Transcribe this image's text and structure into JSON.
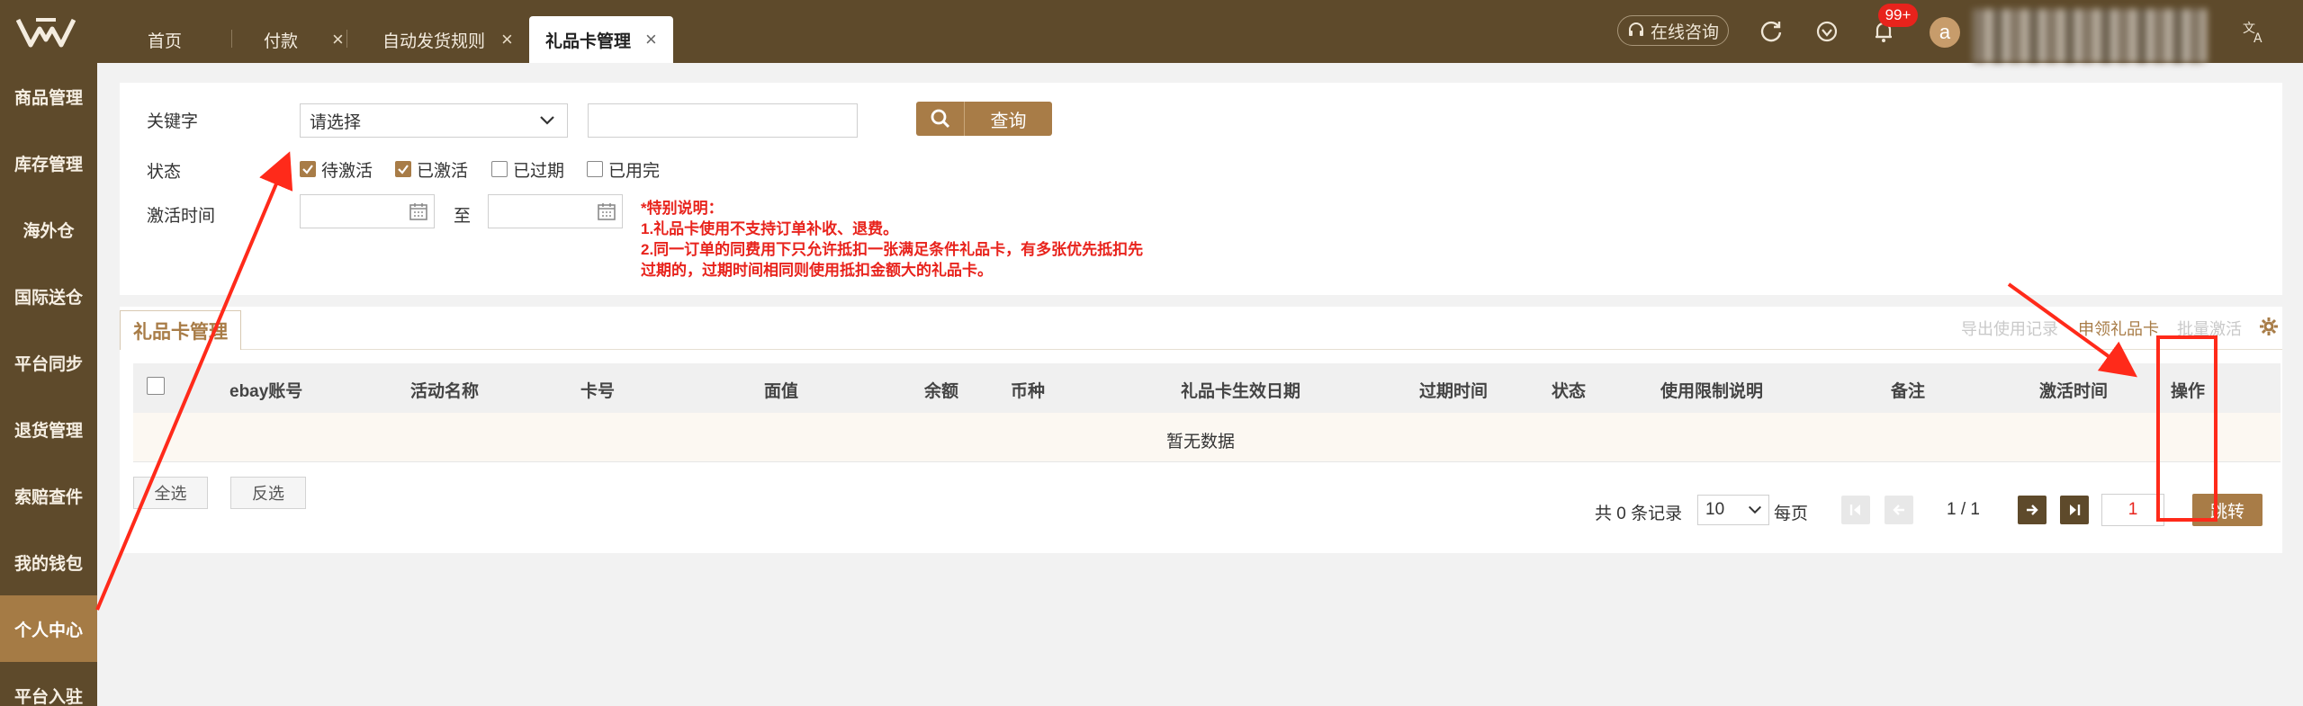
{
  "topbar": {
    "tabs": [
      {
        "label": "首页",
        "closable": false,
        "active": false
      },
      {
        "label": "付款",
        "closable": true,
        "active": false
      },
      {
        "label": "自动发货规则",
        "closable": true,
        "active": false
      },
      {
        "label": "礼品卡管理",
        "closable": true,
        "active": true
      }
    ],
    "close_glyph": "×",
    "consult_label": "在线咨询",
    "notification_count": "99+",
    "avatar_letter": "a",
    "icons": [
      "logo-icon",
      "headset-icon",
      "refresh-icon",
      "heart-icon",
      "bell-icon",
      "translate-icon"
    ]
  },
  "sidebar": {
    "items": [
      {
        "label": "商品管理"
      },
      {
        "label": "库存管理"
      },
      {
        "label": "海外仓"
      },
      {
        "label": "国际送仓"
      },
      {
        "label": "平台同步"
      },
      {
        "label": "退货管理"
      },
      {
        "label": "索赔查件"
      },
      {
        "label": "我的钱包"
      },
      {
        "label": "个人中心",
        "active": true
      },
      {
        "label": "平台入驻"
      }
    ]
  },
  "search": {
    "keyword_label": "关键字",
    "keyword_select_value": "请选择",
    "keyword_input_value": "",
    "query_label": "查询",
    "status_label": "状态",
    "statuses": [
      {
        "label": "待激活",
        "checked": true
      },
      {
        "label": "已激活",
        "checked": true
      },
      {
        "label": "已过期",
        "checked": false
      },
      {
        "label": "已用完",
        "checked": false
      }
    ],
    "activation_time_label": "激活时间",
    "date_separator": "至",
    "date_from_value": "",
    "date_to_value": "",
    "notice": {
      "title": "*特别说明：",
      "line1": "1.礼品卡使用不支持订单补收、退费。",
      "line2": "2.同一订单的同费用下只允许抵扣一张满足条件礼品卡，有多张优先抵扣先",
      "line3": "过期的，过期时间相同则使用抵扣金额大的礼品卡。"
    }
  },
  "table": {
    "panel_tab": "礼品卡管理",
    "toolbar": {
      "export_label": "导出使用记录",
      "apply_label": "申领礼品卡",
      "batch_label": "批量激活"
    },
    "columns": [
      "ebay账号",
      "活动名称",
      "卡号",
      "面值",
      "余额",
      "币种",
      "礼品卡生效日期",
      "过期时间",
      "状态",
      "使用限制说明",
      "备注",
      "激活时间",
      "操作"
    ],
    "rows": [],
    "empty_text": "暂无数据",
    "select_all_label": "全选",
    "invert_label": "反选"
  },
  "pagination": {
    "total_text": "共 0 条记录",
    "page_size": "10",
    "per_page_label": "每页",
    "page_info": "1 / 1",
    "jump_value": "1",
    "jump_label": "跳转"
  },
  "colors": {
    "brand_dark": "#5e4a2b",
    "brand_accent": "#a87c47",
    "notice_red": "#e8231c",
    "annotation_red": "#ff2a1a"
  }
}
